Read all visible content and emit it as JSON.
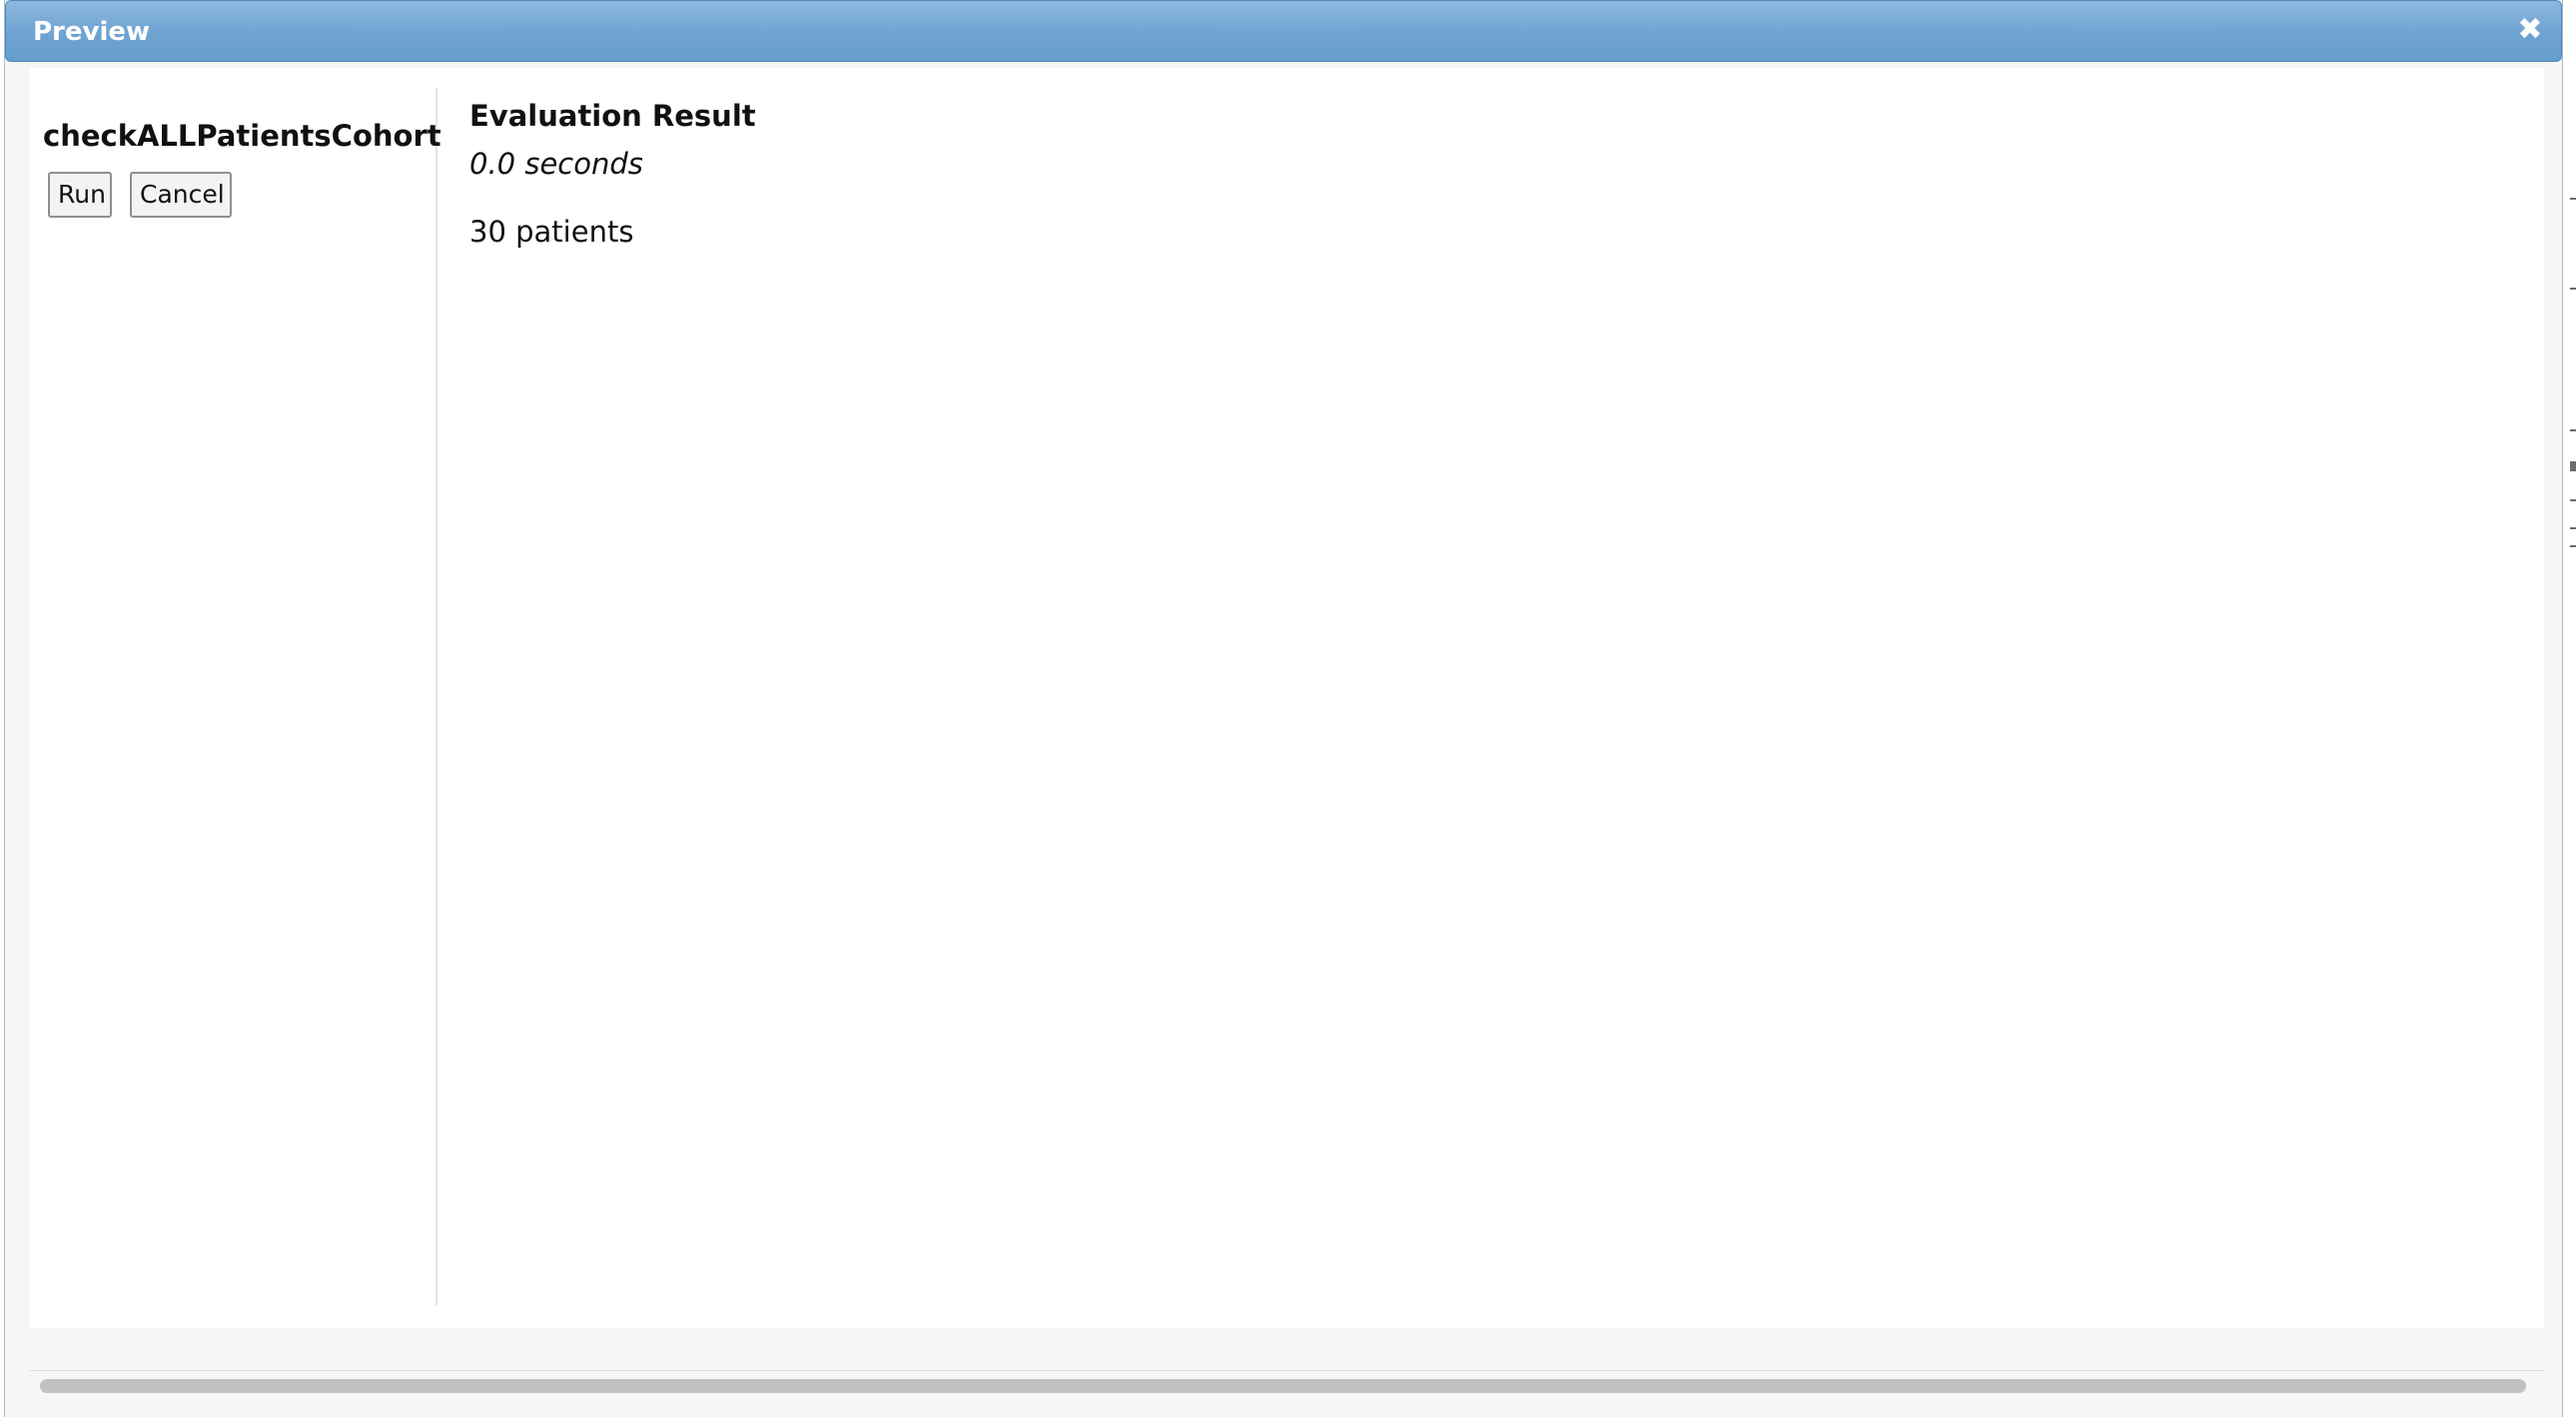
{
  "dialog": {
    "title": "Preview",
    "close_symbol": "✖"
  },
  "left_panel": {
    "cohort_name": "checkALLPatientsCohort",
    "run_label": "Run",
    "cancel_label": "Cancel"
  },
  "result": {
    "heading": "Evaluation Result",
    "duration": "0.0 seconds",
    "patient_count": "30 patients"
  },
  "colors": {
    "titlebar": "#6fa3d1",
    "titlebar_text": "#ffffff",
    "scrollbar_thumb": "#c2c2c2"
  }
}
